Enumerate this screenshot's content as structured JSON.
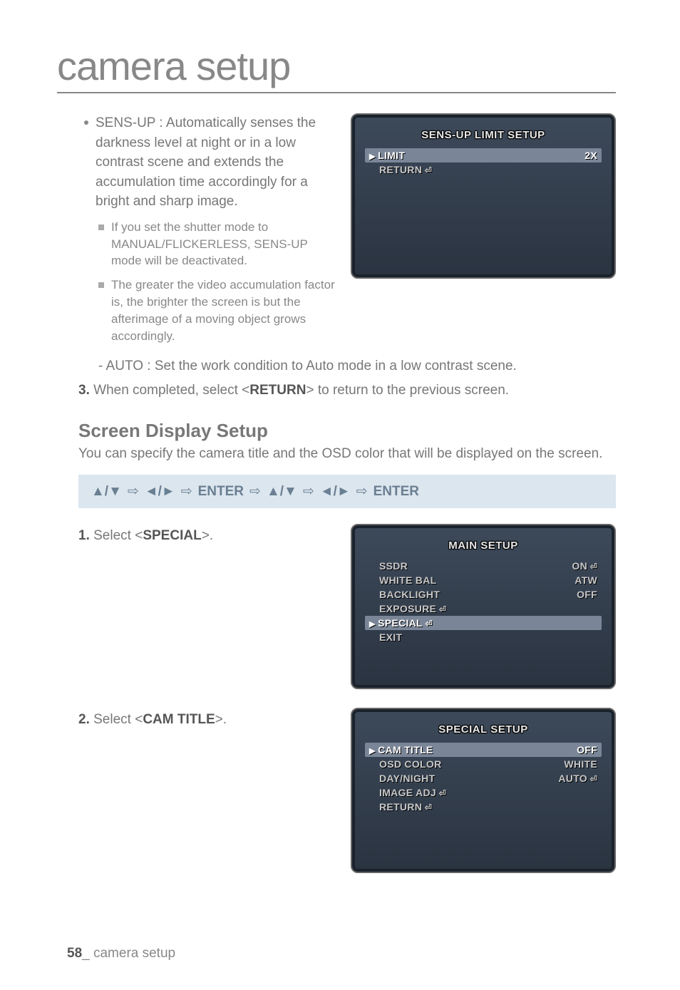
{
  "page_title": "camera setup",
  "sensup": {
    "bullet_main": "SENS-UP : Automatically senses the darkness level at night or in a low contrast scene and extends the accumulation time accordingly for a bright and sharp image.",
    "sub1": "If you set the shutter mode to MANUAL/FLICKERLESS, SENS-UP mode will be deactivated.",
    "sub2": "The greater the video accumulation factor is, the brighter the screen is but the afterimage of a moving object grows accordingly.",
    "dash": "- AUTO : Set the work condition to Auto mode in a low contrast scene."
  },
  "step3_pre": "3.",
  "step3": " When completed, select <",
  "step3_bold": "RETURN",
  "step3_post": "> to return to the previous screen.",
  "section": {
    "head": "Screen Display Setup",
    "body": "You can specify the camera title and the OSD color that will be displayed on the screen."
  },
  "keybar": {
    "g1": "▲/▼",
    "g2": "◄/►",
    "enter": "ENTER",
    "g3": "▲/▼",
    "g4": "◄/►",
    "enter2": "ENTER"
  },
  "step1_pre": "1.",
  "step1": " Select <",
  "step1_bold": "SPECIAL",
  "step1_post": ">.",
  "step2_pre": "2.",
  "step2": " Select <",
  "step2_bold": "CAM TITLE",
  "step2_post": ">.",
  "osd1": {
    "title": "SENS-UP LIMIT SETUP",
    "r1l": "LIMIT",
    "r1r": "2X",
    "r2l": "RETURN"
  },
  "osd2": {
    "title": "MAIN SETUP",
    "r1l": "SSDR",
    "r1r": "ON",
    "r2l": "WHITE BAL",
    "r2r": "ATW",
    "r3l": "BACKLIGHT",
    "r3r": "OFF",
    "r4l": "EXPOSURE",
    "r5l": "SPECIAL",
    "r6l": "EXIT"
  },
  "osd3": {
    "title": "SPECIAL SETUP",
    "r1l": "CAM TITLE",
    "r1r": "OFF",
    "r2l": "OSD COLOR",
    "r2r": "WHITE",
    "r3l": "DAY/NIGHT",
    "r3r": "AUTO",
    "r4l": "IMAGE ADJ",
    "r5l": "RETURN"
  },
  "footer_num": "58",
  "footer_text": "_ camera setup"
}
